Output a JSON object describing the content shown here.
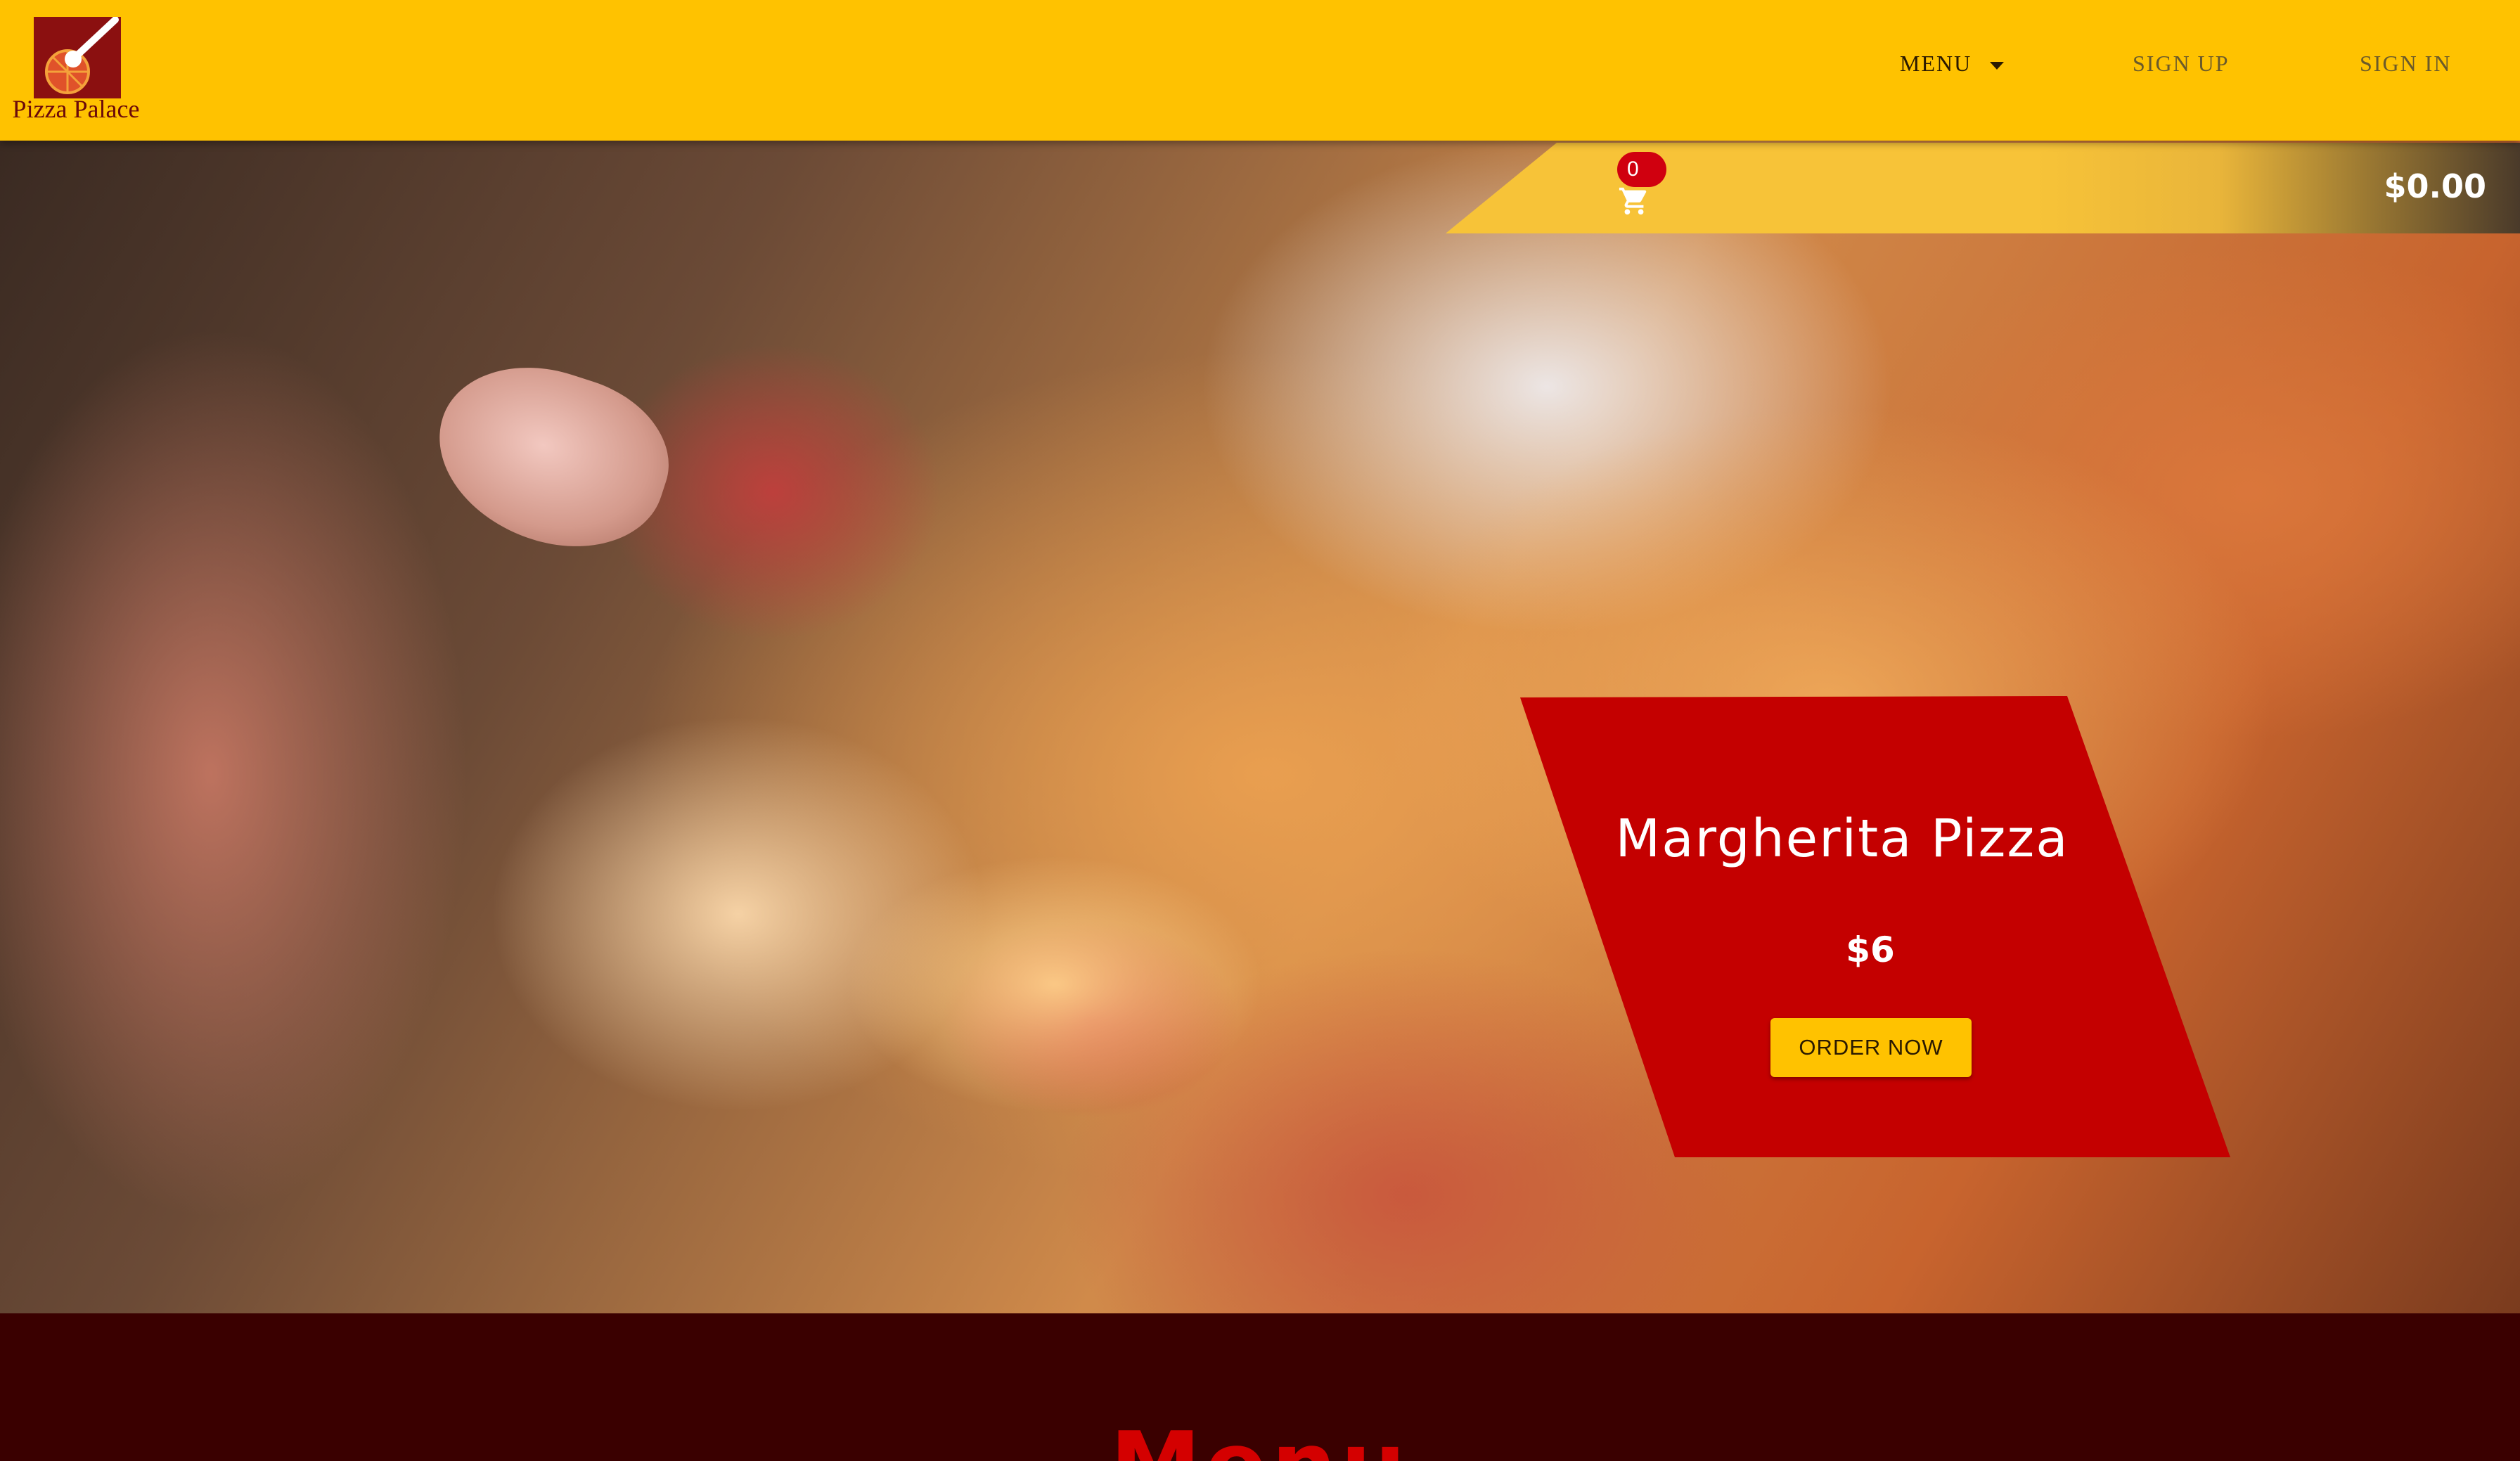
{
  "brand": {
    "name": "Pizza Palace",
    "logo_icon": "pizza-cutter-icon"
  },
  "nav": {
    "menu_label": "MENU",
    "signup_label": "SIGN UP",
    "signin_label": "SIGN IN"
  },
  "cart": {
    "count": "0",
    "total": "$0.00",
    "icon": "shopping-cart-icon"
  },
  "promo": {
    "title": "Margherita Pizza",
    "price": "$6",
    "button_label": "ORDER NOW"
  },
  "menu_section": {
    "heading": "Menu"
  },
  "colors": {
    "navbar": "#ffc200",
    "promo_card": "#c40000",
    "menu_background": "#3a0000",
    "menu_heading": "#d40000",
    "cart_badge": "#d0000f"
  }
}
